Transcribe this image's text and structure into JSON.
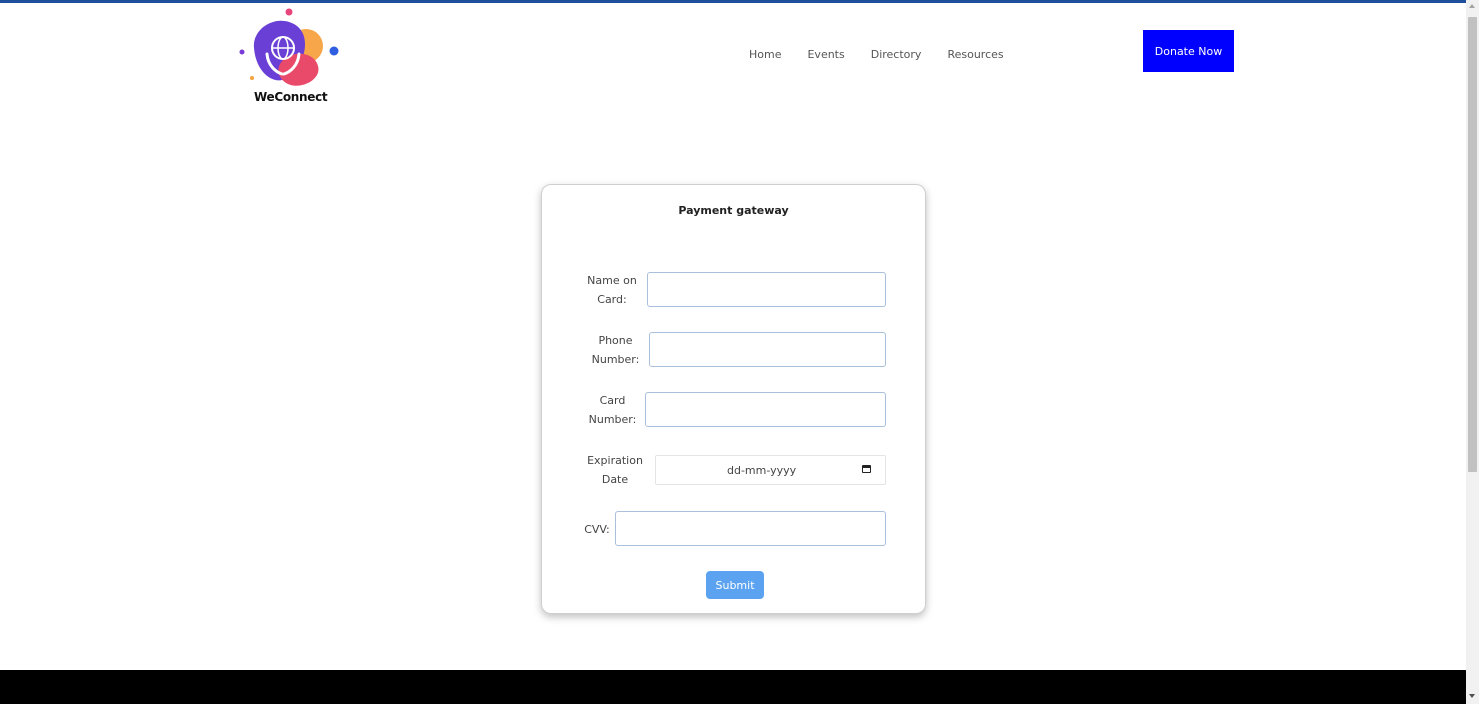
{
  "brand": {
    "name": "WeConnect",
    "logo_icon": "globe-in-hands-icon"
  },
  "nav": {
    "items": [
      "Home",
      "Events",
      "Directory",
      "Resources"
    ]
  },
  "header": {
    "donate_label": "Donate Now"
  },
  "form": {
    "title": "Payment gateway",
    "fields": {
      "name_on_card": {
        "label_line1": "Name on",
        "label_line2": "Card:",
        "value": ""
      },
      "phone_number": {
        "label_line1": "Phone",
        "label_line2": "Number:",
        "value": ""
      },
      "card_number": {
        "label_line1": "Card",
        "label_line2": "Number:",
        "value": ""
      },
      "expiration_date": {
        "label_line1": "Expiration",
        "label_line2": "Date",
        "placeholder": "dd-mm-yyyy",
        "icon": "calendar-icon"
      },
      "cvv": {
        "label": "CVV:",
        "value": ""
      }
    },
    "submit_label": "Submit"
  },
  "colors": {
    "top_border": "#1f4f9c",
    "donate_button": "#0000ff",
    "submit_button": "#5ba3f0",
    "footer": "#000000"
  }
}
